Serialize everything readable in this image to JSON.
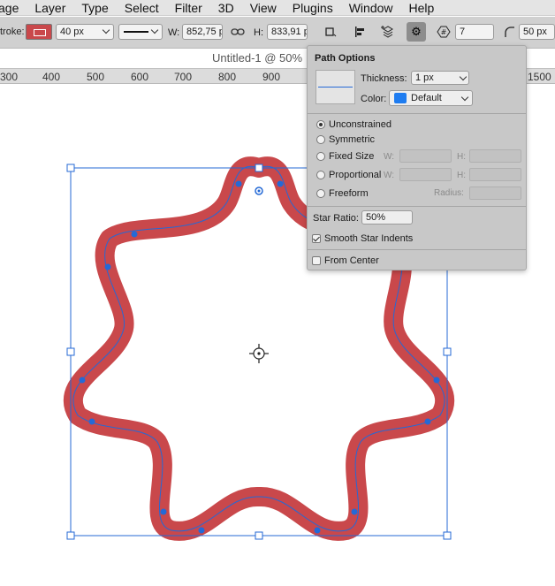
{
  "menu": [
    "age",
    "Layer",
    "Type",
    "Select",
    "Filter",
    "3D",
    "View",
    "Plugins",
    "Window",
    "Help"
  ],
  "options": {
    "stroke_label": "troke:",
    "stroke_width": "40 px",
    "w_label": "W:",
    "w_value": "852,75 p",
    "h_label": "H:",
    "h_value": "833,91 p",
    "star_points": "7",
    "corner_radius": "50 px",
    "stroke_color": "#c9484b"
  },
  "document": {
    "tab_title": "Untitled-1 @ 50%"
  },
  "ruler": [
    {
      "label": "300"
    },
    {
      "label": "400"
    },
    {
      "label": "500"
    },
    {
      "label": "600"
    },
    {
      "label": "700"
    },
    {
      "label": "800"
    },
    {
      "label": "900"
    },
    {
      "label": "1500"
    }
  ],
  "path_options": {
    "title": "Path Options",
    "thickness_label": "Thickness:",
    "thickness_value": "1 px",
    "color_label": "Color:",
    "color_value": "Default",
    "color_swatch": "#1e7cf0",
    "modes": [
      {
        "label": "Unconstrained",
        "selected": true
      },
      {
        "label": "Symmetric",
        "selected": false
      },
      {
        "label": "Fixed Size",
        "selected": false
      },
      {
        "label": "Proportional",
        "selected": false
      },
      {
        "label": "Freeform",
        "selected": false
      }
    ],
    "w_label": "W:",
    "h_label": "H:",
    "radius_label": "Radius:",
    "star_ratio_label": "Star Ratio:",
    "star_ratio_value": "50%",
    "smooth_indents_label": "Smooth Star Indents",
    "smooth_indents_checked": true,
    "from_center_label": "From Center",
    "from_center_checked": false
  },
  "shape": {
    "stroke_color": "#c9484b",
    "path_color": "#2469d6"
  }
}
